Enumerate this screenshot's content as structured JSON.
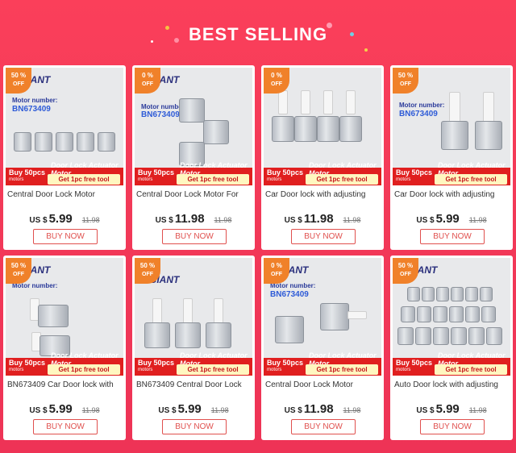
{
  "header": {
    "title": "BEST SELLING"
  },
  "colors": {
    "background": "#f33a58",
    "button": "#e0504e",
    "badge": "#f0812a",
    "banner": "#e01f1f"
  },
  "products": [
    {
      "discount": "50 %",
      "off": "OFF",
      "brand": "GIANT",
      "motor_label": "Motor number:",
      "model": "BN673409",
      "buy": "Buy 50pcs",
      "motors": "motors",
      "gift": "Get 1pc free tool",
      "tag": "Door Lock Actuator Motor",
      "name": "Central Door Lock Motor",
      "currency": "US $",
      "price": "5.99",
      "old_price": "11.98",
      "button": "BUY NOW"
    },
    {
      "discount": "0 %",
      "off": "OFF",
      "brand": "GIANT",
      "motor_label": "Motor number:",
      "model": "BN673409",
      "buy": "Buy 50pcs",
      "motors": "motors",
      "gift": "Get 1pc free tool",
      "tag": "Door Lock Actuator Motor",
      "name": "Central Door Lock Motor For",
      "currency": "US $",
      "price": "11.98",
      "old_price": "11.98",
      "button": "BUY NOW"
    },
    {
      "discount": "0 %",
      "off": "OFF",
      "brand": "",
      "motor_label": "",
      "model": "",
      "buy": "Buy 50pcs",
      "motors": "motors",
      "gift": "Get 1pc free tool",
      "tag": "Door Lock Actuator Motor",
      "name": "Car Door lock with adjusting",
      "currency": "US $",
      "price": "11.98",
      "old_price": "11.98",
      "button": "BUY NOW"
    },
    {
      "discount": "50 %",
      "off": "OFF",
      "brand": "",
      "motor_label": "Motor number:",
      "model": "BN673409",
      "buy": "Buy 50pcs",
      "motors": "motors",
      "gift": "Get 1pc free tool",
      "tag": "Door Lock Actuator Motor",
      "name": "Car Door lock with adjusting",
      "currency": "US $",
      "price": "5.99",
      "old_price": "11.98",
      "button": "BUY NOW"
    },
    {
      "discount": "50 %",
      "off": "OFF",
      "brand": "GIANT",
      "motor_label": "Motor number:",
      "model": "",
      "buy": "Buy 50pcs",
      "motors": "motors",
      "gift": "Get 1pc free tool",
      "tag": "Door Lock Actuator Motor",
      "name": "BN673409 Car Door lock with",
      "currency": "US $",
      "price": "5.99",
      "old_price": "11.98",
      "button": "BUY NOW"
    },
    {
      "discount": "50 %",
      "off": "OFF",
      "brand": "GIANT",
      "motor_label": "Motor number:",
      "model": "BN673409",
      "buy": "Buy 50pcs",
      "motors": "motors",
      "gift": "Get 1pc free tool",
      "tag": "Door Lock Actuator Motor",
      "name": "BN673409 Central Door Lock",
      "currency": "US $",
      "price": "5.99",
      "old_price": "11.98",
      "button": "BUY NOW"
    },
    {
      "discount": "0 %",
      "off": "OFF",
      "brand": "GIANT",
      "motor_label": "Motor number:",
      "model": "BN673409",
      "buy": "Buy 50pcs",
      "motors": "motors",
      "gift": "Get 1pc free tool",
      "tag": "Door Lock Actuator Motor",
      "name": "Central Door Lock Motor",
      "currency": "US $",
      "price": "11.98",
      "old_price": "11.98",
      "button": "BUY NOW"
    },
    {
      "discount": "50 %",
      "off": "OFF",
      "brand": "GIANT",
      "motor_label": "",
      "model": "",
      "buy": "Buy 50pcs",
      "motors": "motors",
      "gift": "Get 1pc free tool",
      "tag": "Door Lock Actuator Motor",
      "name": "Auto Door lock with adjusting",
      "currency": "US $",
      "price": "5.99",
      "old_price": "11.98",
      "button": "BUY NOW"
    }
  ]
}
